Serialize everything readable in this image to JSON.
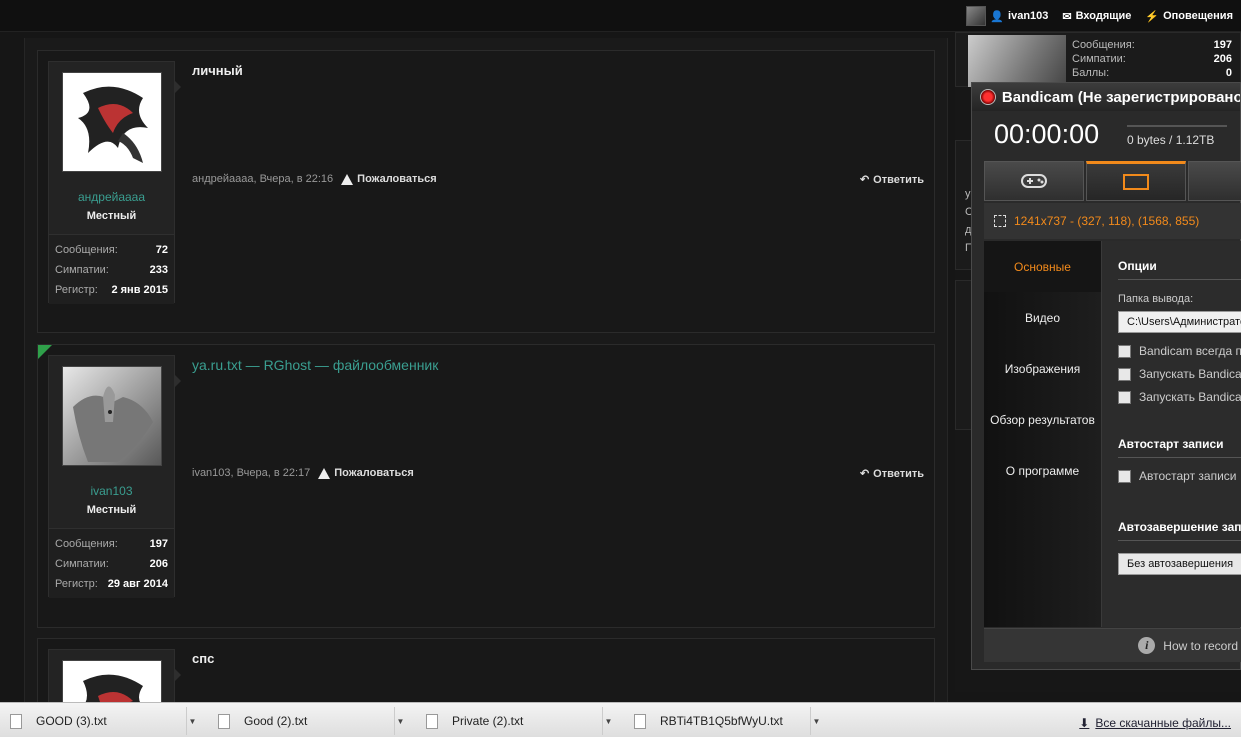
{
  "topbar": {
    "username": "ivan103",
    "inbox": "Входящие",
    "alerts": "Оповещения"
  },
  "posts": [
    {
      "author": "андрейаааа",
      "title": "Местный",
      "stats": [
        [
          "Сообщения:",
          "72"
        ],
        [
          "Симпатии:",
          "233"
        ],
        [
          "Регистр:",
          "2 янв 2015"
        ]
      ],
      "message": "личный",
      "meta": "андрейаааа, Вчера, в 22:16",
      "report": "Пожаловаться",
      "reply": "Ответить"
    },
    {
      "author": "ivan103",
      "title": "Местный",
      "stats": [
        [
          "Сообщения:",
          "197"
        ],
        [
          "Симпатии:",
          "206"
        ],
        [
          "Регистр:",
          "29 авг 2014"
        ]
      ],
      "message": "ya.ru.txt — RGhost — файлообменник",
      "meta": "ivan103, Вчера, в 22:17",
      "report": "Пожаловаться",
      "reply": "Ответить"
    },
    {
      "message": "спс"
    }
  ],
  "sidebar": {
    "stats": [
      [
        "Сообщения:",
        "197"
      ],
      [
        "Симпатии:",
        "206"
      ],
      [
        "Баллы:",
        "0"
      ]
    ],
    "fragments": [
      "у",
      "С",
      "д",
      "П"
    ]
  },
  "bandicam": {
    "title": "Bandicam (Не зарегистрировано)",
    "timer": "00:00:00",
    "size": "0 bytes / 1.12TB",
    "region": "1241x737 - (327, 118), (1568, 855)",
    "nav": [
      "Основные",
      "Видео",
      "Изображения",
      "Обзор результатов",
      "О программе"
    ],
    "options_header": "Опции",
    "output_label": "Папка вывода:",
    "output_value": "C:\\Users\\Администратор",
    "checkboxes": [
      "Bandicam всегда поверх",
      "Запускать Bandicam",
      "Запускать Bandicam"
    ],
    "autostart_header": "Автостарт записи",
    "autostart_cb": "Автостарт записи",
    "autostop_header": "Автозавершение записи",
    "autostop_value": "Без автозавершения",
    "footer": "How to record"
  },
  "downloads": {
    "items": [
      "GOOD (3).txt",
      "Good (2).txt",
      "Private (2).txt",
      "RBTi4TB1Q5bfWyU.txt"
    ],
    "all": "Все скачанные файлы..."
  },
  "colors": {
    "accent_teal": "#3a9e90",
    "bandicam_orange": "#f28a1b"
  }
}
